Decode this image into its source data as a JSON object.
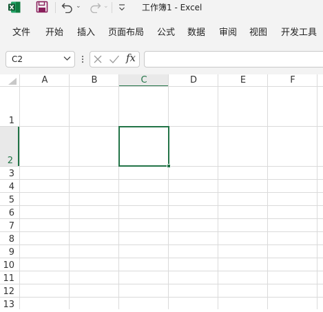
{
  "title_bar": {
    "window_title": "工作簿1  -  Excel",
    "undo_dropdown": "⌄",
    "redo_dropdown": "⌄"
  },
  "ribbon": {
    "tabs": [
      "文件",
      "开始",
      "插入",
      "页面布局",
      "公式",
      "数据",
      "审阅",
      "视图",
      "开发工具"
    ]
  },
  "formula_bar": {
    "name_box_value": "C2",
    "fx_label": "fx",
    "formula_value": ""
  },
  "sheet": {
    "columns": [
      "A",
      "B",
      "C",
      "D",
      "E",
      "F"
    ],
    "rows": [
      "1",
      "2",
      "3",
      "4",
      "5",
      "6",
      "7",
      "8",
      "9",
      "10",
      "11",
      "12",
      "13"
    ],
    "selected_cell": "C2",
    "selected_column": "C",
    "selected_row": "2"
  },
  "colors": {
    "accent": "#217346",
    "save_icon": "#8a1f5c",
    "chrome_bg": "#f3f3f3",
    "gridline": "#dadada"
  },
  "icons": [
    "excel-app-icon",
    "save-icon",
    "undo-icon",
    "redo-icon",
    "customize-quick-access-icon",
    "chevron-down-icon",
    "more-options-icon",
    "cancel-x-icon",
    "enter-check-icon",
    "fx-icon",
    "select-all-triangle-icon"
  ]
}
